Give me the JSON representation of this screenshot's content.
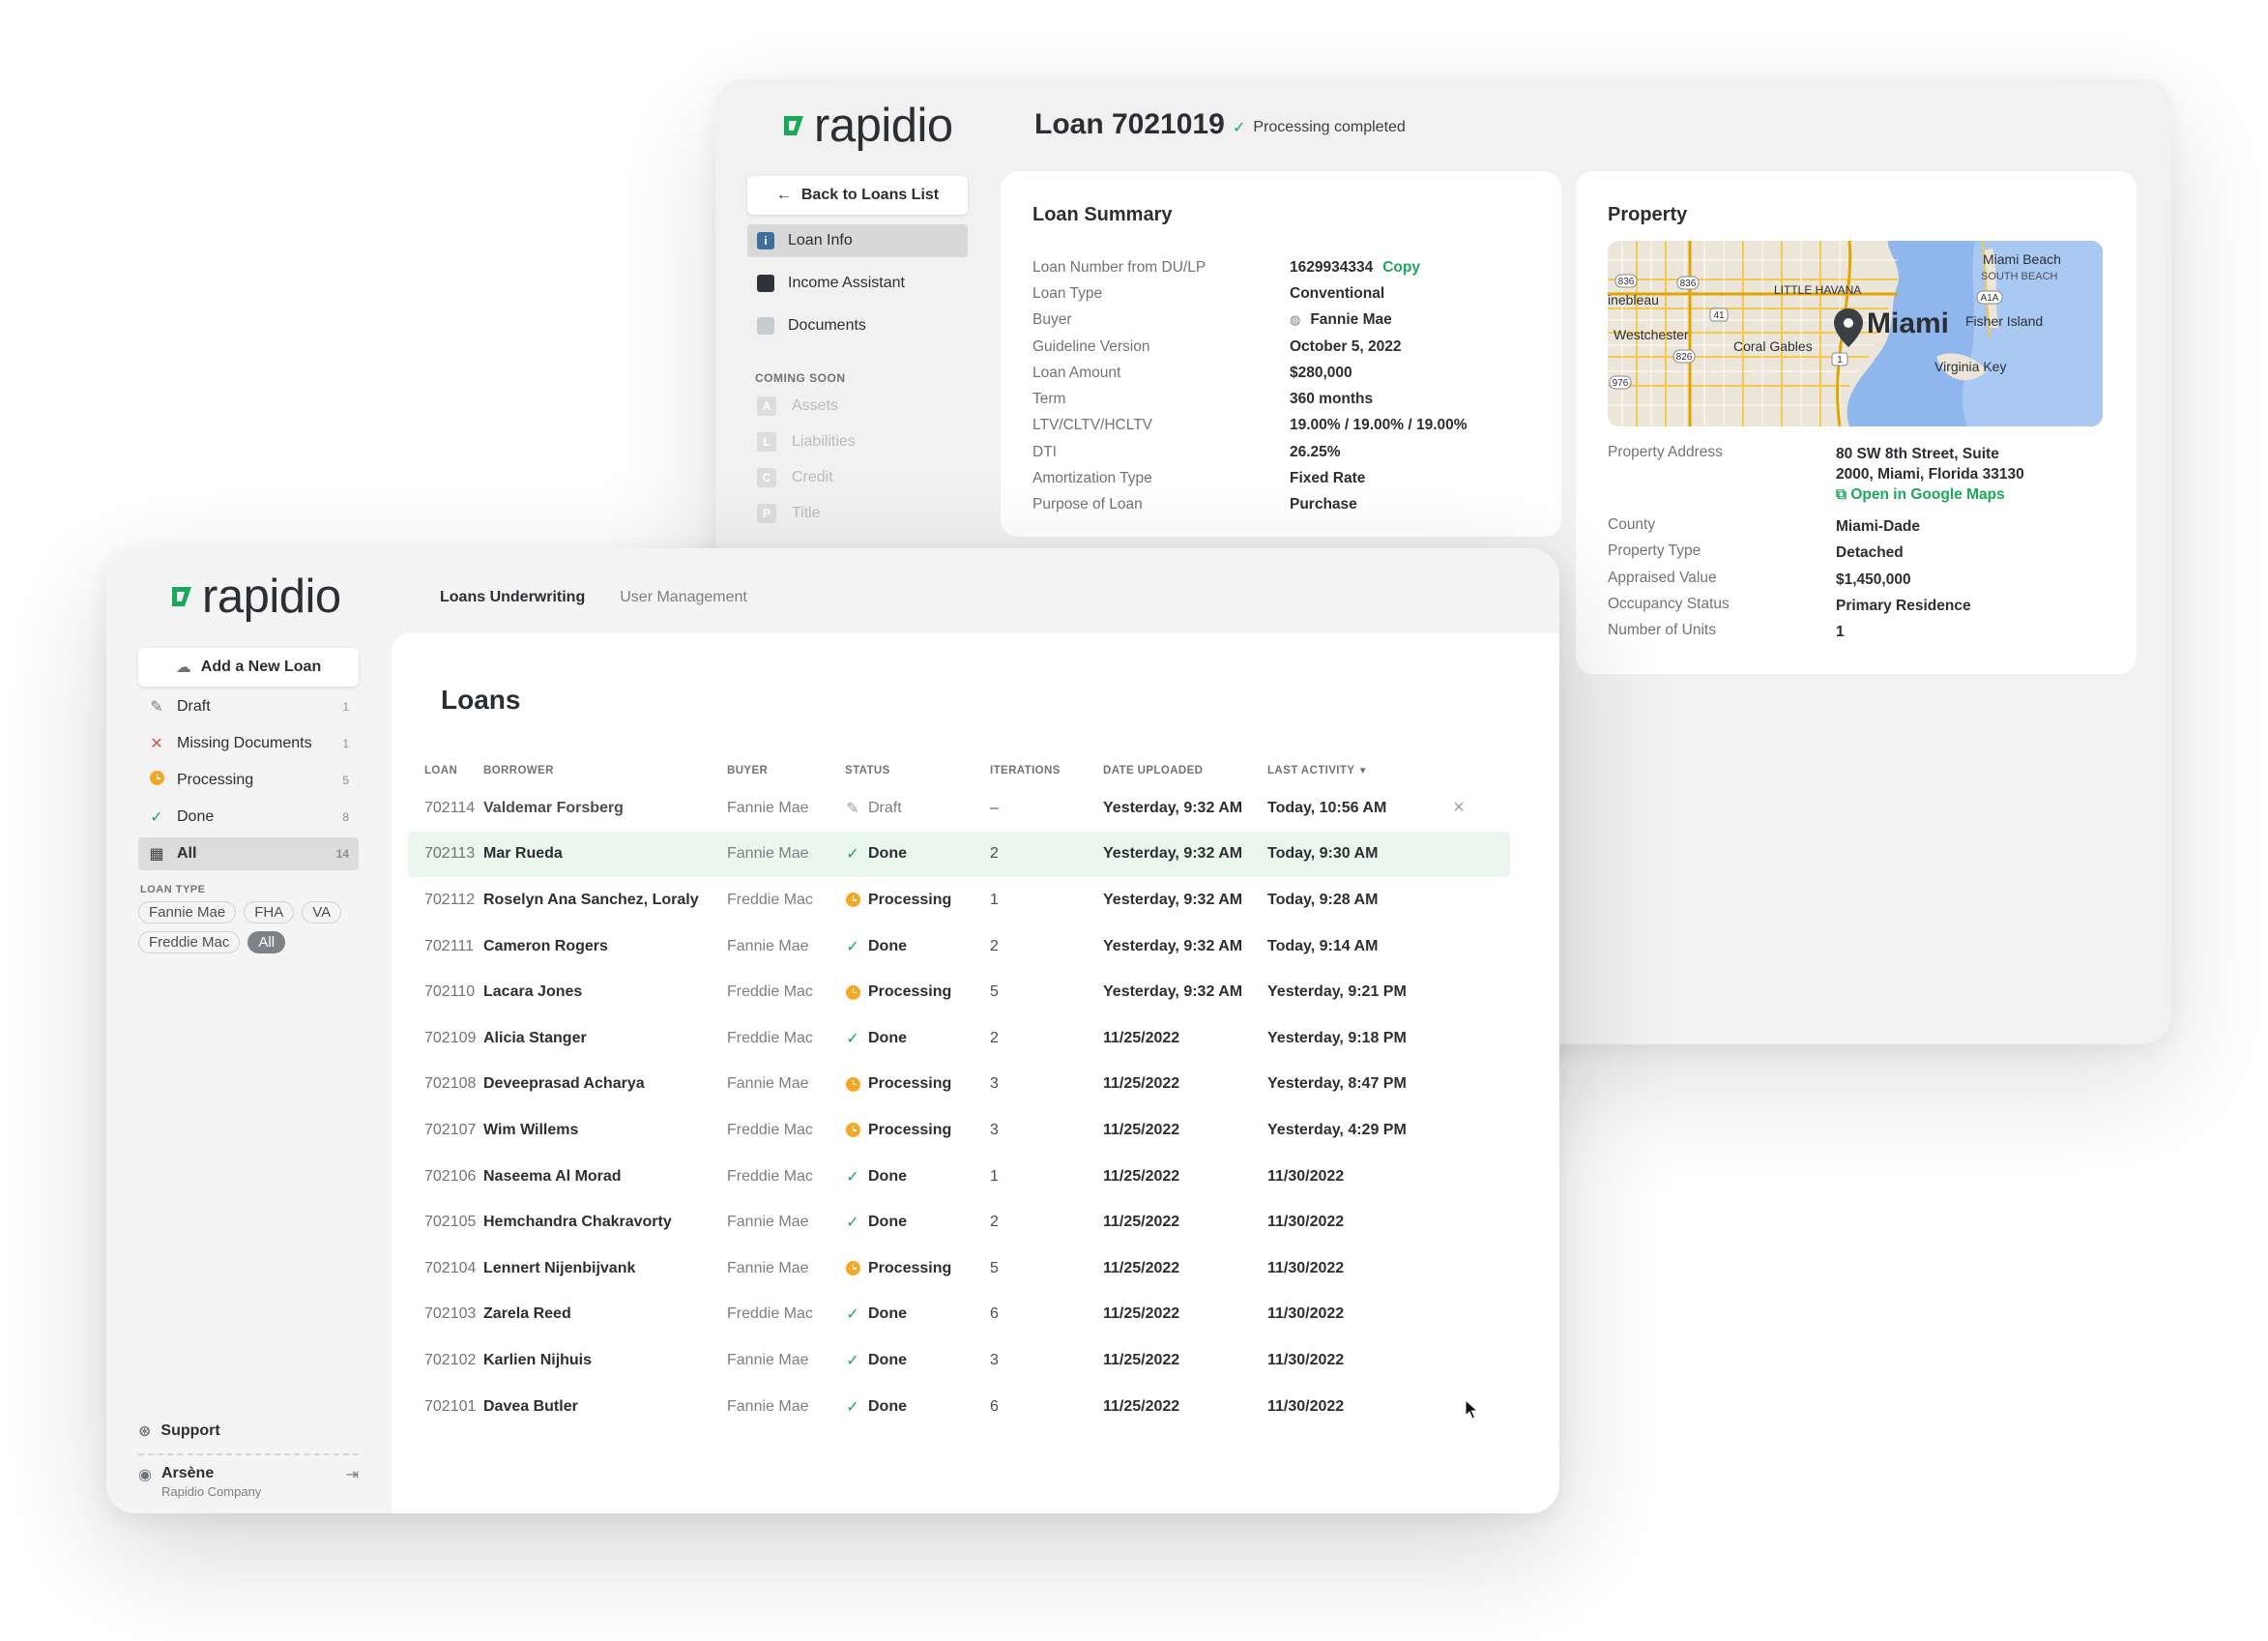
{
  "brand": {
    "name": "rapidio",
    "accent": "#1aa85a"
  },
  "detail": {
    "title": "Loan 7021019",
    "status": "Processing completed",
    "back_label": "Back to Loans List",
    "nav": [
      {
        "label": "Loan Info",
        "icon": "info-icon",
        "active": true
      },
      {
        "label": "Income Assistant",
        "icon": "calculator-icon",
        "active": false
      },
      {
        "label": "Documents",
        "icon": "document-icon",
        "active": false
      }
    ],
    "coming_soon_label": "COMING SOON",
    "coming_soon": [
      {
        "letter": "A",
        "label": "Assets"
      },
      {
        "letter": "L",
        "label": "Liabilities"
      },
      {
        "letter": "C",
        "label": "Credit"
      },
      {
        "letter": "P",
        "label": "Title"
      }
    ],
    "summary": {
      "title": "Loan Summary",
      "copy_label": "Copy",
      "rows": [
        {
          "key": "Loan Number from DU/LP",
          "value": "1629934334"
        },
        {
          "key": "Loan Type",
          "value": "Conventional"
        },
        {
          "key": "Buyer",
          "value": "Fannie Mae"
        },
        {
          "key": "Guideline Version",
          "value": "October 5, 2022"
        },
        {
          "key": "Loan Amount",
          "value": "$280,000"
        },
        {
          "key": "Term",
          "value": "360 months"
        },
        {
          "key": "LTV/CLTV/HCLTV",
          "value": "19.00% / 19.00% / 19.00%"
        },
        {
          "key": "DTI",
          "value": "26.25%"
        },
        {
          "key": "Amortization Type",
          "value": "Fixed Rate"
        },
        {
          "key": "Purpose of Loan",
          "value": "Purchase"
        }
      ]
    },
    "property": {
      "title": "Property",
      "map_labels": {
        "city": "Miami",
        "miami_beach": "Miami Beach",
        "south_beach": "SOUTH BEACH",
        "little_havana": "LITTLE HAVANA",
        "fisher_island": "Fisher Island",
        "westchester": "Westchester",
        "coral_gables": "Coral Gables",
        "virginia_key": "Virginia Key",
        "hialeah": "inebleau",
        "r836": "836",
        "r836b": "836",
        "r41": "41",
        "r826": "826",
        "r976": "976",
        "r1": "1",
        "a1a": "A1A"
      },
      "address_key": "Property Address",
      "address_line1": "80 SW 8th Street, Suite",
      "address_line2": "2000, Miami, Florida 33130",
      "maps_link": "Open in Google Maps",
      "rows": [
        {
          "key": "County",
          "value": "Miami-Dade"
        },
        {
          "key": "Property Type",
          "value": "Detached"
        },
        {
          "key": "Appraised Value",
          "value": "$1,450,000"
        },
        {
          "key": "Occupancy Status",
          "value": "Primary Residence"
        },
        {
          "key": "Number of Units",
          "value": "1"
        }
      ]
    }
  },
  "list": {
    "tabs": [
      {
        "label": "Loans Underwriting",
        "active": true
      },
      {
        "label": "User Management",
        "active": false
      }
    ],
    "add_label": "Add a New Loan",
    "filters": [
      {
        "label": "Draft",
        "count": "1",
        "icon": "pencil-icon"
      },
      {
        "label": "Missing Documents",
        "count": "1",
        "icon": "x-icon"
      },
      {
        "label": "Processing",
        "count": "5",
        "icon": "clock-icon"
      },
      {
        "label": "Done",
        "count": "8",
        "icon": "check-icon"
      },
      {
        "label": "All",
        "count": "14",
        "icon": "grid-icon"
      }
    ],
    "loan_type_label": "LOAN TYPE",
    "loan_types": [
      {
        "label": "Fannie Mae",
        "active": false
      },
      {
        "label": "FHA",
        "active": false
      },
      {
        "label": "VA",
        "active": false
      },
      {
        "label": "Freddie Mac",
        "active": false
      },
      {
        "label": "All",
        "active": true
      }
    ],
    "support_label": "Support",
    "user": {
      "name": "Arsène",
      "company": "Rapidio Company"
    },
    "title": "Loans",
    "columns": [
      "LOAN",
      "BORROWER",
      "BUYER",
      "STATUS",
      "ITERATIONS",
      "DATE UPLOADED",
      "LAST ACTIVITY"
    ],
    "rows": [
      {
        "loan": "702114",
        "borrower": "Valdemar Forsberg",
        "buyer": "Fannie Mae",
        "status": "Draft",
        "iterations": "–",
        "uploaded": "Yesterday, 9:32 AM",
        "activity": "Today, 10:56 AM"
      },
      {
        "loan": "702113",
        "borrower": "Mar Rueda",
        "buyer": "Fannie Mae",
        "status": "Done",
        "iterations": "2",
        "uploaded": "Yesterday, 9:32 AM",
        "activity": "Today, 9:30 AM"
      },
      {
        "loan": "702112",
        "borrower": "Roselyn Ana Sanchez, Loraly",
        "buyer": "Freddie Mac",
        "status": "Processing",
        "iterations": "1",
        "uploaded": "Yesterday, 9:32 AM",
        "activity": "Today, 9:28 AM"
      },
      {
        "loan": "702111",
        "borrower": "Cameron Rogers",
        "buyer": "Fannie Mae",
        "status": "Done",
        "iterations": "2",
        "uploaded": "Yesterday, 9:32 AM",
        "activity": "Today, 9:14 AM"
      },
      {
        "loan": "702110",
        "borrower": "Lacara Jones",
        "buyer": "Freddie Mac",
        "status": "Processing",
        "iterations": "5",
        "uploaded": "Yesterday, 9:32 AM",
        "activity": "Yesterday, 9:21 PM"
      },
      {
        "loan": "702109",
        "borrower": "Alicia Stanger",
        "buyer": "Freddie Mac",
        "status": "Done",
        "iterations": "2",
        "uploaded": "11/25/2022",
        "activity": "Yesterday, 9:18 PM"
      },
      {
        "loan": "702108",
        "borrower": "Deveeprasad Acharya",
        "buyer": "Fannie Mae",
        "status": "Processing",
        "iterations": "3",
        "uploaded": "11/25/2022",
        "activity": "Yesterday, 8:47 PM"
      },
      {
        "loan": "702107",
        "borrower": "Wim Willems",
        "buyer": "Freddie Mac",
        "status": "Processing",
        "iterations": "3",
        "uploaded": "11/25/2022",
        "activity": "Yesterday, 4:29 PM"
      },
      {
        "loan": "702106",
        "borrower": "Naseema Al Morad",
        "buyer": "Freddie Mac",
        "status": "Done",
        "iterations": "1",
        "uploaded": "11/25/2022",
        "activity": "11/30/2022"
      },
      {
        "loan": "702105",
        "borrower": "Hemchandra Chakravorty",
        "buyer": "Fannie Mae",
        "status": "Done",
        "iterations": "2",
        "uploaded": "11/25/2022",
        "activity": "11/30/2022"
      },
      {
        "loan": "702104",
        "borrower": "Lennert Nijenbijvank",
        "buyer": "Fannie Mae",
        "status": "Processing",
        "iterations": "5",
        "uploaded": "11/25/2022",
        "activity": "11/30/2022"
      },
      {
        "loan": "702103",
        "borrower": "Zarela Reed",
        "buyer": "Freddie Mac",
        "status": "Done",
        "iterations": "6",
        "uploaded": "11/25/2022",
        "activity": "11/30/2022"
      },
      {
        "loan": "702102",
        "borrower": "Karlien Nijhuis",
        "buyer": "Fannie Mae",
        "status": "Done",
        "iterations": "3",
        "uploaded": "11/25/2022",
        "activity": "11/30/2022"
      },
      {
        "loan": "702101",
        "borrower": "Davea Butler",
        "buyer": "Fannie Mae",
        "status": "Done",
        "iterations": "6",
        "uploaded": "11/25/2022",
        "activity": "11/30/2022"
      }
    ]
  }
}
